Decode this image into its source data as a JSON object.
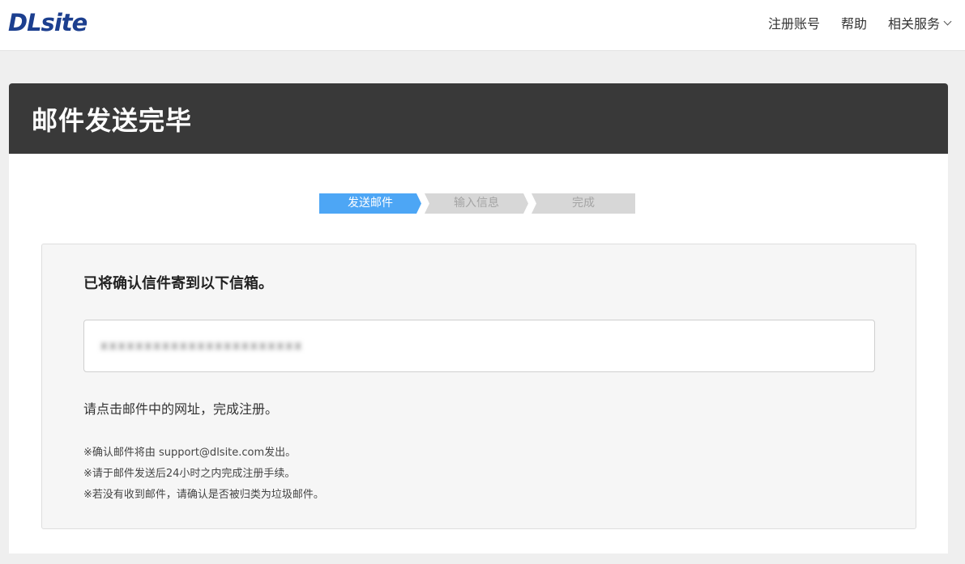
{
  "header": {
    "logo_text": "DLsite",
    "nav": [
      {
        "label": "注册账号"
      },
      {
        "label": "帮助"
      },
      {
        "label": "相关服务"
      }
    ]
  },
  "page": {
    "title": "邮件发送完毕"
  },
  "steps": [
    {
      "label": "发送邮件",
      "state": "active"
    },
    {
      "label": "输入信息",
      "state": "inactive"
    },
    {
      "label": "完成",
      "state": "inactive"
    }
  ],
  "panel": {
    "heading": "已将确认信件寄到以下信箱。",
    "email_value": "xxxxxxxxxxxxxxxxxxxxxxx",
    "instruction": "请点击邮件中的网址，完成注册。",
    "notes": [
      "※确认邮件将由 support@dlsite.com发出。",
      "※请于邮件发送后24小时之内完成注册手续。",
      "※若没有收到邮件，请确认是否被归类为垃圾邮件。"
    ]
  },
  "colors": {
    "brand": "#1c3f8f",
    "step_active": "#4da6f5",
    "step_inactive": "#d7d7d7",
    "title_bar": "#393939"
  }
}
